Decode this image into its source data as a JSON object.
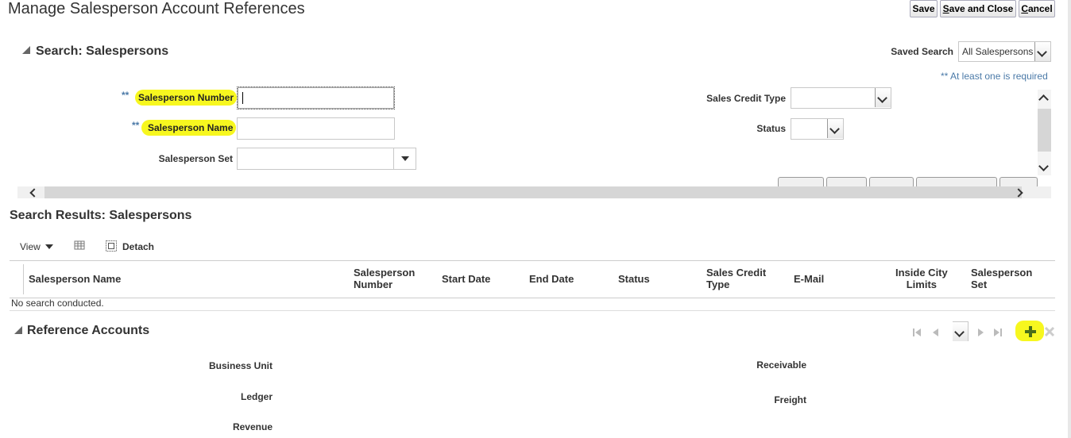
{
  "page": {
    "title": "Manage Salesperson Account References"
  },
  "toolbar": {
    "save_label": "Save",
    "save_close_first": "S",
    "save_close_rest": "ave and Close",
    "cancel_first": "C",
    "cancel_rest": "ancel"
  },
  "search": {
    "title": "Search: Salespersons",
    "saved_search_label": "Saved Search",
    "saved_search_value": "All Salespersons",
    "required_note": "** At least one is required",
    "required_marker": "**",
    "fields": {
      "salesperson_number_label": "Salesperson Number",
      "salesperson_name_label": "Salesperson Name",
      "salesperson_set_label": "Salesperson Set",
      "sales_credit_type_label": "Sales Credit Type",
      "status_label": "Status"
    }
  },
  "results": {
    "title": "Search Results: Salespersons",
    "view_label": "View",
    "detach_label": "Detach",
    "columns": [
      {
        "line1": "Salesperson Name",
        "line2": ""
      },
      {
        "line1": "Salesperson",
        "line2": "Number"
      },
      {
        "line1": "Start Date",
        "line2": ""
      },
      {
        "line1": "End Date",
        "line2": ""
      },
      {
        "line1": "Status",
        "line2": ""
      },
      {
        "line1": "Sales Credit",
        "line2": "Type"
      },
      {
        "line1": "E-Mail",
        "line2": ""
      },
      {
        "line1": "Inside City",
        "line2": "Limits"
      },
      {
        "line1": "Salesperson",
        "line2": "Set"
      }
    ],
    "empty_text": "No search conducted."
  },
  "reference_accounts": {
    "title": "Reference Accounts",
    "labels_left": [
      "Business Unit",
      "Ledger",
      "Revenue"
    ],
    "labels_right": [
      "Receivable",
      "Freight"
    ]
  },
  "icons": {
    "add": "plus-icon",
    "delete": "close-icon",
    "highlight_color": "#f7f71f"
  }
}
